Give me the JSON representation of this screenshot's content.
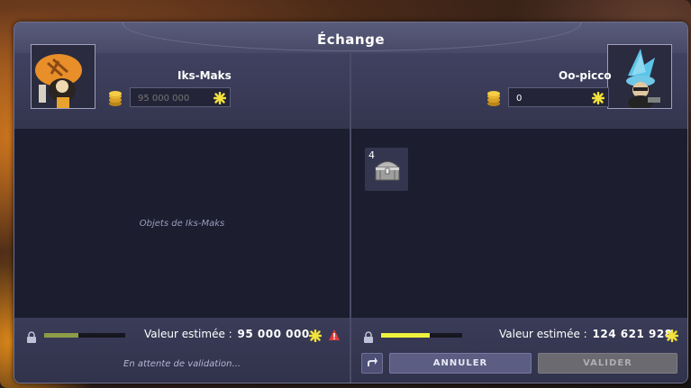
{
  "window": {
    "title": "Échange"
  },
  "left": {
    "player_name": "Iks-Maks",
    "kamas_placeholder": "95 000 000",
    "kamas_value": "",
    "items_placeholder": "Objets de Iks-Maks",
    "estimated_label": "Valeur estimée :",
    "estimated_value": "95 000 000",
    "bar_fill": 0.42,
    "status": "En attente de validation...",
    "icons": [
      "avatar",
      "coins-icon",
      "kamas-icon",
      "lock-icon",
      "warning-icon"
    ]
  },
  "right": {
    "player_name": "Oo-picco",
    "kamas_placeholder": "",
    "kamas_value": "0",
    "items": [
      {
        "quantity": "4",
        "icon": "chest-icon"
      }
    ],
    "estimated_label": "Valeur estimée :",
    "estimated_value": "124 621 928",
    "bar_fill": 0.6,
    "buttons": {
      "cancel": "ANNULER",
      "validate": "VALIDER"
    },
    "icons": [
      "avatar",
      "coins-icon",
      "kamas-icon",
      "lock-icon",
      "share-icon"
    ]
  },
  "colors": {
    "kamas": "#f3e23a",
    "left_bar": "#8d9c46",
    "right_bar": "#eef23c",
    "warning": "#e23b3b"
  }
}
